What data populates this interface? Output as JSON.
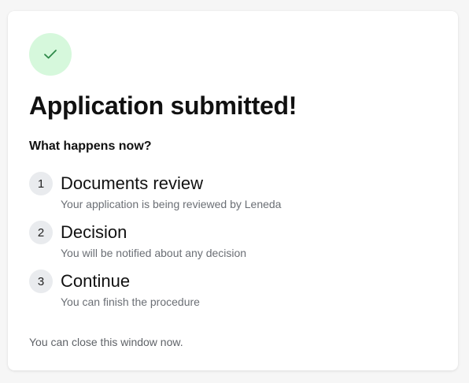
{
  "card": {
    "title": "Application submitted!",
    "subtitle": "What happens now?",
    "steps": [
      {
        "number": "1",
        "title": "Documents review",
        "description": "Your application is being reviewed by Leneda"
      },
      {
        "number": "2",
        "title": "Decision",
        "description": "You will be notified about any decision"
      },
      {
        "number": "3",
        "title": "Continue",
        "description": "You can finish the procedure"
      }
    ],
    "footer_note": "You can close this window now."
  },
  "colors": {
    "success_circle_bg": "#d6f8dc",
    "success_check": "#2f8a4a",
    "step_badge_bg": "#e9ebee",
    "muted_text": "#6b6f75"
  },
  "icons": {
    "success": "check-icon"
  }
}
